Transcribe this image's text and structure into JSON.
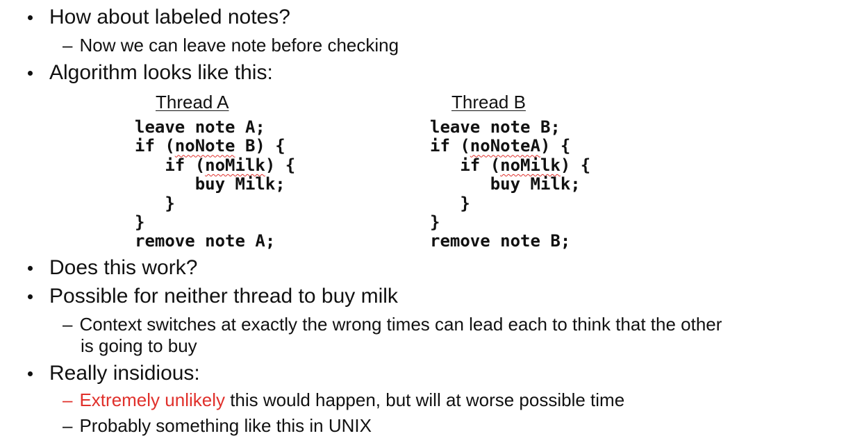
{
  "bullets": {
    "b1": "How about labeled notes?",
    "b1_sub1": "Now we can leave note before checking",
    "b2": "Algorithm looks like this:",
    "b3": "Does this work?",
    "b4": "Possible for neither thread to buy milk",
    "b4_sub1_line1": "Context switches at exactly the wrong times can lead each to think that the other",
    "b4_sub1_line2": "is going to buy",
    "b5": "Really insidious:",
    "b5_sub1_red": "Extremely unlikely",
    "b5_sub1_rest": " this would happen, but will at worse possible time",
    "b5_sub2": "Probably something like this in UNIX"
  },
  "dash": "–",
  "threads": {
    "a": {
      "title": "Thread A",
      "l1": "leave note A;",
      "l2a": "if (",
      "l2b": "noNote",
      "l2c": " B) {",
      "l3a": "   if (",
      "l3b": "noMilk",
      "l3c": ") {",
      "l4": "      buy Milk;",
      "l5": "   }",
      "l6": "}",
      "l7": "remove note A;"
    },
    "b": {
      "title": "Thread B",
      "l1": "leave note B;",
      "l2a": "if (",
      "l2b": "noNoteA",
      "l2c": ") {",
      "l3a": "   if (",
      "l3b": "noMilk",
      "l3c": ") {",
      "l4": "      buy Milk;",
      "l5": "   }",
      "l6": "}",
      "l7": "remove note B;"
    }
  },
  "colors": {
    "accent_red": "#e0302b",
    "text": "#111111",
    "background": "#ffffff"
  }
}
